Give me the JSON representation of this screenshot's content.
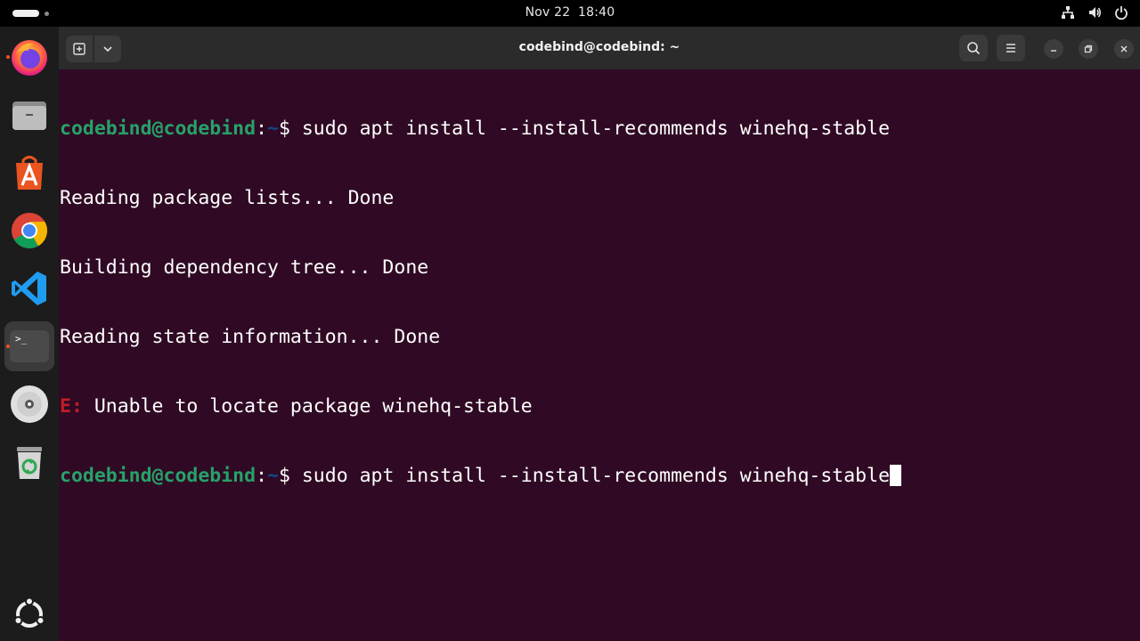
{
  "topbar": {
    "date": "Nov 22",
    "time": "18:40"
  },
  "dock": {
    "items": [
      {
        "name": "firefox"
      },
      {
        "name": "files"
      },
      {
        "name": "app-center"
      },
      {
        "name": "chrome"
      },
      {
        "name": "vscode"
      },
      {
        "name": "terminal",
        "active": true
      },
      {
        "name": "disc"
      },
      {
        "name": "trash"
      },
      {
        "name": "show-apps"
      }
    ],
    "terminal_icon_text": ">_"
  },
  "window": {
    "title": "codebind@codebind: ~"
  },
  "terminal": {
    "lines": [
      {
        "user": "codebind@codebind",
        "sep": ":",
        "path": "~",
        "prompt": "$ ",
        "cmd": "sudo apt install --install-recommends winehq-stable"
      },
      {
        "text": "Reading package lists... Done"
      },
      {
        "text": "Building dependency tree... Done"
      },
      {
        "text": "Reading state information... Done"
      },
      {
        "err": "E:",
        "text": " Unable to locate package winehq-stable"
      },
      {
        "user": "codebind@codebind",
        "sep": ":",
        "path": "~",
        "prompt": "$ ",
        "cmd": "sudo apt install --install-recommends winehq-stable"
      }
    ]
  },
  "colors": {
    "terminal_bg": "#300a24",
    "user": "#26a269",
    "path": "#12488b",
    "error": "#c01c28",
    "headerbar": "#2b2b2b",
    "dock": "#1c1c1c"
  }
}
